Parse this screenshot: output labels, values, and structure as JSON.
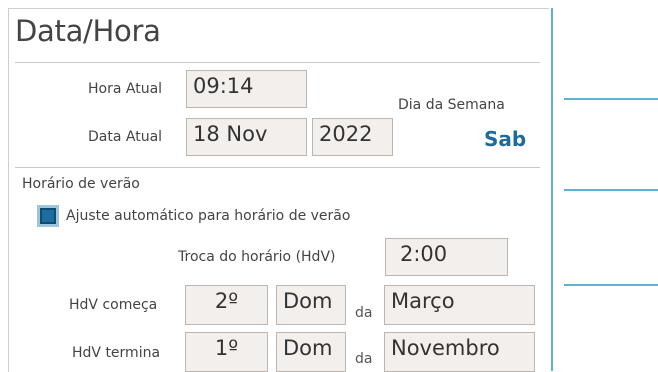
{
  "title": "Data/Hora",
  "time": {
    "label": "Hora Atual",
    "value": "09:14"
  },
  "date": {
    "label": "Data Atual",
    "day_month": "18 Nov",
    "year": "2022"
  },
  "weekday": {
    "label": "Dia da Semana",
    "value": "Sab"
  },
  "dst": {
    "section_label": "Horário de verão",
    "auto_label": "Ajuste automático para horário de verão",
    "auto_checked": true,
    "change_label": "Troca do horário (HdV)",
    "change_value": "2:00",
    "start": {
      "label": "HdV começa",
      "ordinal": "2º",
      "day": "Dom",
      "of": "da",
      "month": "Março"
    },
    "end": {
      "label": "HdV termina",
      "ordinal": "1º",
      "day": "Dom",
      "of": "da",
      "month": "Novembro"
    }
  },
  "colors": {
    "accent": "#1f6a9a",
    "sidebar_line": "#5fb2d2",
    "field_bg": "#f3efec"
  }
}
